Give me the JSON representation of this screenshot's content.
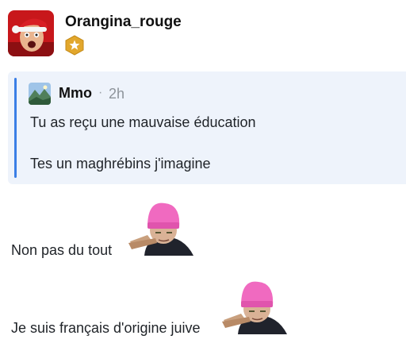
{
  "post": {
    "username": "Orangina_rouge",
    "avatar_icon": "santa-face-avatar-icon",
    "badge_icon": "gold-star-badge-icon"
  },
  "quote": {
    "username": "Mmo",
    "separator": "·",
    "time": "2h",
    "avatar_icon": "landscape-avatar-icon",
    "lines": [
      "Tu as reçu une mauvaise éducation",
      "Tes un maghrébins j'imagine"
    ]
  },
  "messages": [
    {
      "text": "Non pas du tout",
      "sticker_icon": "pink-beanie-man-sticker"
    },
    {
      "text": "Je suis français d'origine juive",
      "sticker_icon": "pink-beanie-man-sticker"
    }
  ],
  "colors": {
    "quote_bg": "#eef3fb",
    "quote_bar": "#3a7ee6",
    "badge_gold": "#e2a72c",
    "beanie_pink": "#f06ac0"
  }
}
